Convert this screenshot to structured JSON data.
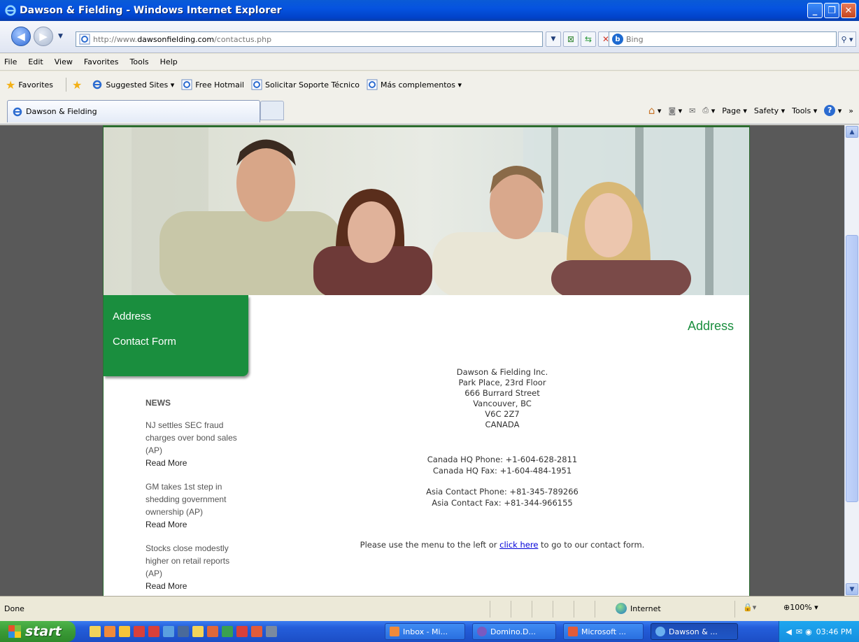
{
  "window": {
    "title": "Dawson & Fielding - Windows Internet Explorer",
    "controls": [
      "_",
      "❐",
      "✕"
    ]
  },
  "addressbar": {
    "url_prefix": "http://www.",
    "url_domain": "dawsonfielding.com",
    "url_path": "/contactus.php",
    "search_placeholder": "Bing"
  },
  "menubar": {
    "items": [
      "File",
      "Edit",
      "View",
      "Favorites",
      "Tools",
      "Help"
    ]
  },
  "favorites_bar": {
    "favorites_label": "Favorites",
    "links": [
      "Suggested Sites ▾",
      "Free Hotmail",
      "Solicitar Soporte Técnico",
      "Más complementos ▾"
    ]
  },
  "tabs": {
    "active_tab": "Dawson & Fielding"
  },
  "command_bar": {
    "page": "Page ▾",
    "safety": "Safety ▾",
    "tools": "Tools ▾",
    "more": "»"
  },
  "site": {
    "menu": [
      "Address",
      "Contact Form"
    ],
    "news": {
      "heading": "NEWS",
      "items": [
        {
          "headline": "NJ settles SEC fraud charges over bond sales (AP)",
          "link": "Read More"
        },
        {
          "headline": "GM takes 1st step in shedding government ownership (AP)",
          "link": "Read More"
        },
        {
          "headline": "Stocks close modestly higher on retail reports (AP)",
          "link": "Read More"
        }
      ]
    },
    "heading": "Address",
    "address_lines": [
      "Dawson & Fielding Inc.",
      "Park Place, 23rd Floor",
      "666 Burrard Street",
      "Vancouver, BC",
      "V6C 2Z7",
      "CANADA"
    ],
    "contacts": {
      "canada_phone": "Canada HQ Phone: +1-604-628-2811",
      "canada_fax": "Canada HQ Fax: +1-604-484-1951",
      "asia_phone": "Asia Contact Phone: +81-345-789266",
      "asia_fax": "Asia Contact Fax: +81-344-966155"
    },
    "form_prompt_before": "Please use the menu to the left or ",
    "form_link": "click here",
    "form_prompt_after": " to go to our contact form."
  },
  "statusbar": {
    "status": "Done",
    "zone": "Internet",
    "zoom": "100%"
  },
  "taskbar": {
    "start": "start",
    "items": [
      "Inbox - Mi...",
      "Domino.D...",
      "Microsoft ...",
      "Dawson & ..."
    ],
    "clock": "03:46 PM"
  },
  "colors": {
    "brand_green": "#1a8e3e",
    "xp_blue": "#245edb"
  }
}
